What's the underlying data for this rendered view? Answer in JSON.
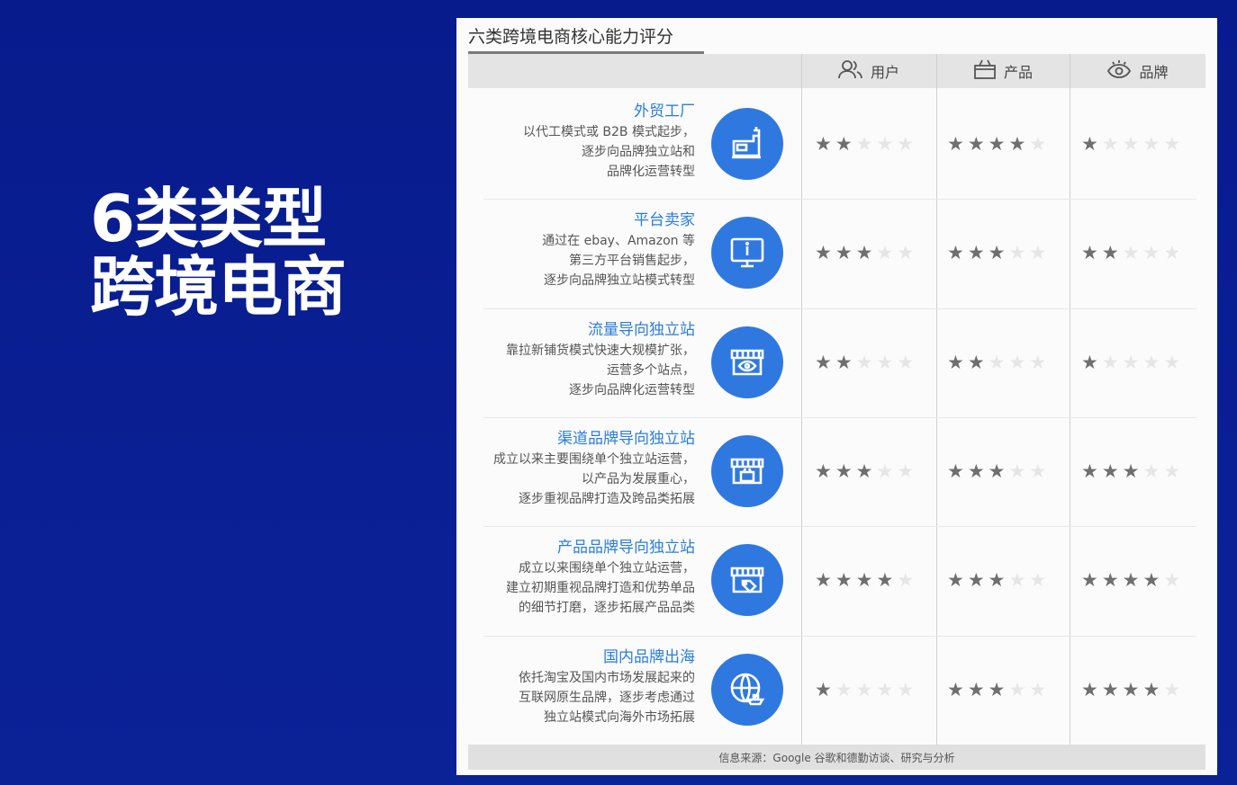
{
  "slide": {
    "title_line1": "6类类型",
    "title_line2": "跨境电商"
  },
  "table": {
    "title": "六类跨境电商核心能力评分",
    "columns": [
      {
        "label": "用户",
        "icon": "user-icon"
      },
      {
        "label": "产品",
        "icon": "box-icon"
      },
      {
        "label": "品牌",
        "icon": "eye-icon"
      }
    ],
    "rows": [
      {
        "name": "外贸工厂",
        "lines": [
          "以代工模式或 B2B 模式起步，",
          "逐步向品牌独立站和",
          "品牌化运营转型"
        ],
        "icon": "sewing-machine-icon",
        "ratings": [
          2,
          4,
          1
        ]
      },
      {
        "name": "平台卖家",
        "lines": [
          "通过在 ebay、Amazon 等",
          "第三方平台销售起步，",
          "逐步向品牌独立站模式转型"
        ],
        "icon": "monitor-icon",
        "ratings": [
          3,
          3,
          2
        ]
      },
      {
        "name": "流量导向独立站",
        "lines": [
          "靠拉新铺货模式快速大规模扩张，",
          "运营多个站点，",
          "逐步向品牌化运营转型"
        ],
        "icon": "store-eye-icon",
        "ratings": [
          2,
          2,
          1
        ]
      },
      {
        "name": "渠道品牌导向独立站",
        "lines": [
          "成立以来主要围绕单个独立站运营，",
          "以产品为发展重心，",
          "逐步重视品牌打造及跨品类拓展"
        ],
        "icon": "store-box-icon",
        "ratings": [
          3,
          3,
          3
        ]
      },
      {
        "name": "产品品牌导向独立站",
        "lines": [
          "成立以来围绕单个独立站运营，",
          "建立初期重视品牌打造和优势单品",
          "的细节打磨，逐步拓展产品品类"
        ],
        "icon": "store-tag-icon",
        "ratings": [
          4,
          3,
          4
        ]
      },
      {
        "name": "国内品牌出海",
        "lines": [
          "依托淘宝及国内市场发展起来的",
          "互联网原生品牌，逐步考虑通过",
          "独立站模式向海外市场拓展"
        ],
        "icon": "globe-ship-icon",
        "ratings": [
          1,
          3,
          4
        ]
      }
    ],
    "footer": "信息来源：Google 谷歌和德勤访谈、研究与分析",
    "max_stars": 5
  }
}
